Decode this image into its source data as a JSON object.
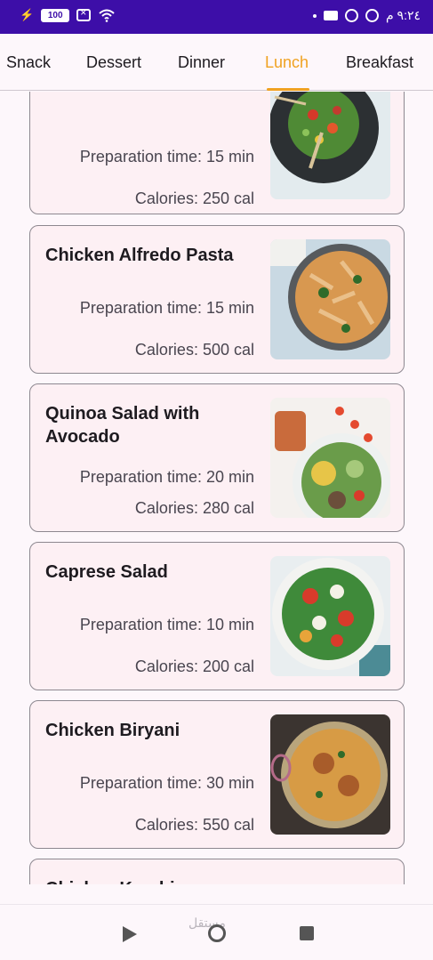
{
  "status_bar": {
    "battery": "100",
    "time": "٩:٢٤ م",
    "bg_color": "#3d0ea8"
  },
  "tabs": [
    {
      "label": "Snack",
      "active": false
    },
    {
      "label": "Dessert",
      "active": false
    },
    {
      "label": "Dinner",
      "active": false
    },
    {
      "label": "Lunch",
      "active": true
    },
    {
      "label": "Breakfast",
      "active": false
    }
  ],
  "accent_color": "#f0a221",
  "recipes": [
    {
      "title": "",
      "prep": "Preparation time: 15 min",
      "calories": "Calories: 250 cal",
      "image": "salad-bowl-photo"
    },
    {
      "title": "Chicken Alfredo Pasta",
      "prep": "Preparation time: 15 min",
      "calories": "Calories: 500 cal",
      "image": "pasta-photo"
    },
    {
      "title": "Quinoa Salad with Avocado",
      "prep": "Preparation time: 20 min",
      "calories": "Calories: 280 cal",
      "image": "quinoa-salad-photo"
    },
    {
      "title": "Caprese Salad",
      "prep": "Preparation time: 10 min",
      "calories": "Calories: 200 cal",
      "image": "caprese-photo"
    },
    {
      "title": "Chicken Biryani",
      "prep": "Preparation time: 30 min",
      "calories": "Calories: 550 cal",
      "image": "biryani-photo"
    },
    {
      "title": "Chicken Karahi",
      "prep": "",
      "calories": "",
      "image": ""
    }
  ],
  "watermark": "مستقل"
}
